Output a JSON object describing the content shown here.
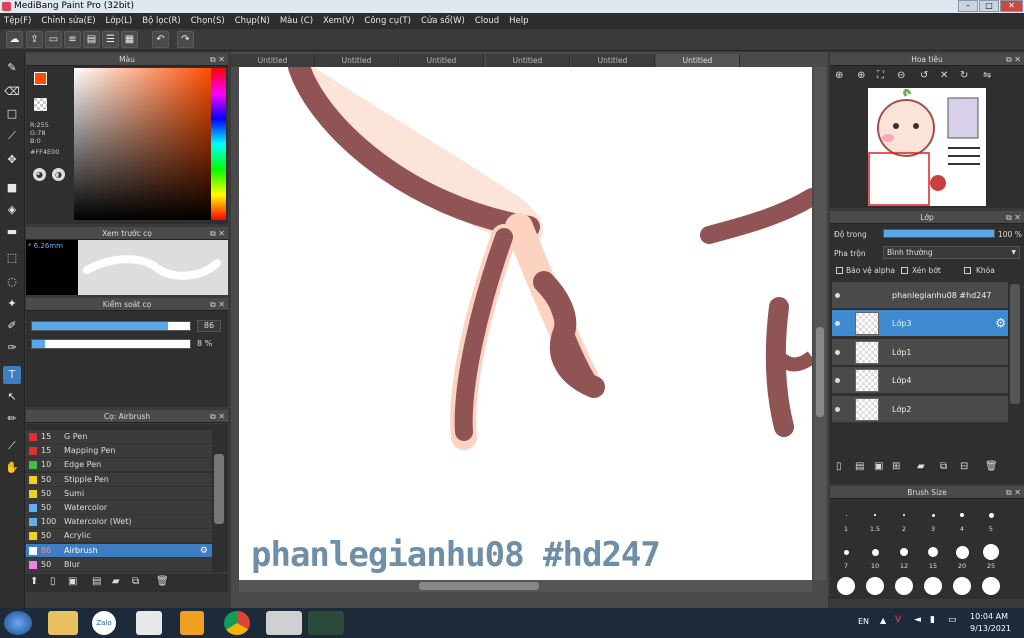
{
  "window": {
    "title": "MediBang Paint Pro (32bit)"
  },
  "menu": [
    "Tệp(F)",
    "Chỉnh sửa(E)",
    "Lớp(L)",
    "Bộ lọc(R)",
    "Chọn(S)",
    "Chụp(N)",
    "Màu (C)",
    "Xem(V)",
    "Công cụ(T)",
    "Cửa sổ(W)",
    "Cloud",
    "Help"
  ],
  "color_panel": {
    "title": "Màu",
    "r": "R:255",
    "g": "G:78",
    "b": "B:0",
    "hex": "#FF4E00",
    "fg_color": "#ff4e00",
    "bg_color": "#ffffff"
  },
  "brush_preview": {
    "title": "Xem trước cọ",
    "size": "* 6.26mm"
  },
  "brush_control": {
    "title": "Kiểm soát cọ",
    "size_value": "86",
    "opacity_value": "8 %",
    "size_fraction": 0.86,
    "opacity_fraction": 0.08
  },
  "brush_list": {
    "title": "Cọ: Airbrush",
    "items": [
      {
        "size": "15",
        "name": "G Pen",
        "color": "#e03030"
      },
      {
        "size": "15",
        "name": "Mapping Pen",
        "color": "#e03030"
      },
      {
        "size": "10",
        "name": "Edge Pen",
        "color": "#40c040"
      },
      {
        "size": "50",
        "name": "Stipple Pen",
        "color": "#f0d020"
      },
      {
        "size": "50",
        "name": "Sumi",
        "color": "#f0d020"
      },
      {
        "size": "50",
        "name": "Watercolor",
        "color": "#60b0f0"
      },
      {
        "size": "100",
        "name": "Watercolor (Wet)",
        "color": "#60b0f0"
      },
      {
        "size": "50",
        "name": "Acrylic",
        "color": "#f0d020"
      },
      {
        "size": "86",
        "name": "Airbrush",
        "color": "#ffffff"
      },
      {
        "size": "50",
        "name": "Blur",
        "color": "#f080f0"
      }
    ],
    "selected_index": 8
  },
  "tabs": [
    "Untitled",
    "Untitled",
    "Untitled",
    "Untitled",
    "Untitled",
    "Untitled"
  ],
  "active_tab": 5,
  "canvas": {
    "watermark": "phanlegianhu08 #hd247"
  },
  "navigator": {
    "title": "Hoa tiêu"
  },
  "layers": {
    "title": "Lớp",
    "opacity_label": "Độ trong",
    "opacity_value": "100 %",
    "blend_label": "Pha trộn",
    "blend_value": "Bình thường",
    "protect_alpha": "Bảo vệ alpha",
    "clipping": "Xén bớt",
    "lock": "Khóa",
    "items": [
      {
        "name": "phanlegianhu08 #hd247"
      },
      {
        "name": "Lớp3"
      },
      {
        "name": "Lớp1"
      },
      {
        "name": "Lớp4"
      },
      {
        "name": "Lớp2"
      }
    ],
    "selected_index": 1
  },
  "brush_size": {
    "title": "Brush Size",
    "sizes": [
      "1",
      "1.5",
      "2",
      "3",
      "4",
      "5",
      "7",
      "10",
      "12",
      "15",
      "20",
      "25"
    ]
  },
  "taskbar": {
    "lang": "EN",
    "time": "10:04 AM",
    "date": "9/13/2021"
  }
}
